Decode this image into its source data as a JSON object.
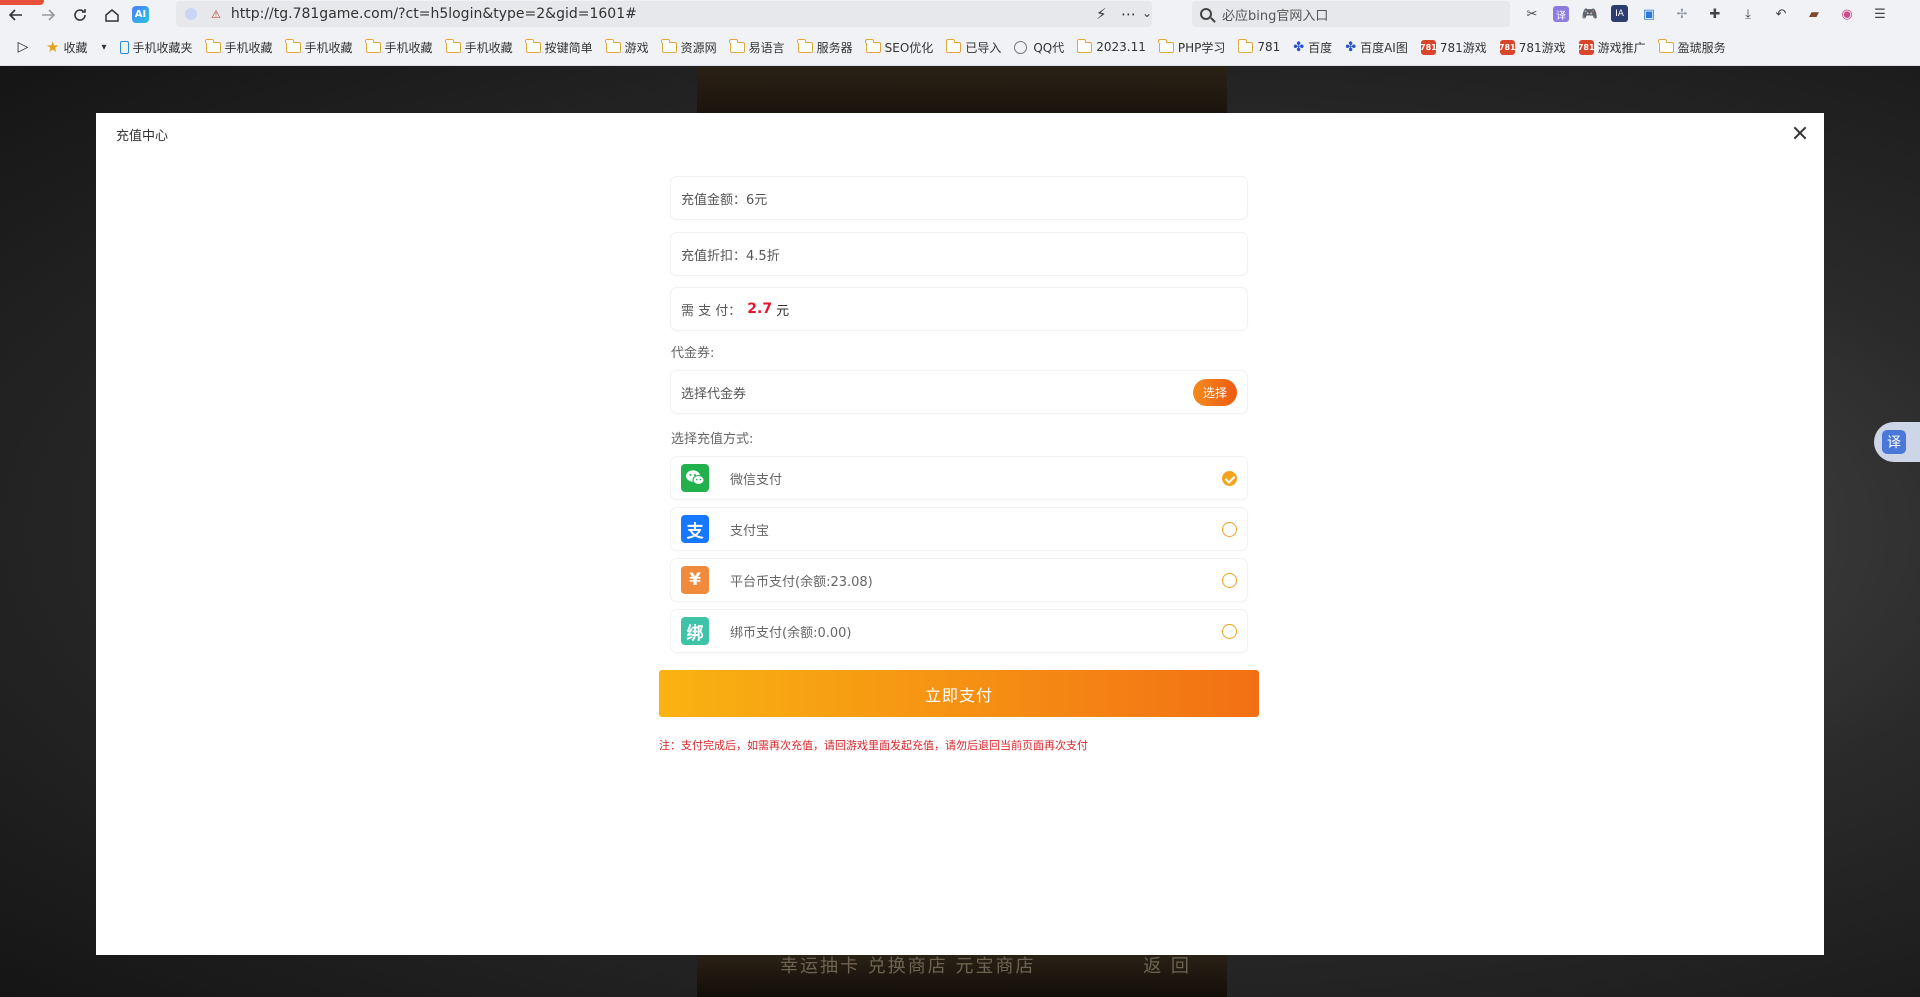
{
  "browser": {
    "url": "http://tg.781game.com/?ct=h5login&type=2&gid=1601#",
    "search_placeholder": "必应bing官网入口",
    "ai_label": "AI"
  },
  "bookmarks": [
    {
      "label": "收藏",
      "icon": "star-icon"
    },
    {
      "label": "手机收藏夹",
      "icon": "phone-icon"
    },
    {
      "label": "手机收藏",
      "icon": "folder-icon"
    },
    {
      "label": "手机收藏",
      "icon": "folder-icon"
    },
    {
      "label": "手机收藏",
      "icon": "folder-icon"
    },
    {
      "label": "手机收藏",
      "icon": "folder-icon"
    },
    {
      "label": "按键简单",
      "icon": "folder-icon"
    },
    {
      "label": "游戏",
      "icon": "folder-icon"
    },
    {
      "label": "资源网",
      "icon": "folder-icon"
    },
    {
      "label": "易语言",
      "icon": "folder-icon"
    },
    {
      "label": "服务器",
      "icon": "folder-icon"
    },
    {
      "label": "SEO优化",
      "icon": "folder-icon"
    },
    {
      "label": "已导入",
      "icon": "folder-icon"
    },
    {
      "label": "QQ代",
      "icon": "globe-icon"
    },
    {
      "label": "2023.11",
      "icon": "folder-icon"
    },
    {
      "label": "PHP学习",
      "icon": "folder-icon"
    },
    {
      "label": "781",
      "icon": "folder-icon"
    },
    {
      "label": "百度",
      "icon": "paw-icon"
    },
    {
      "label": "百度AI图",
      "icon": "paw-icon"
    },
    {
      "label": "781游戏",
      "icon": "badge-icon",
      "badge": "781"
    },
    {
      "label": "781游戏",
      "icon": "badge-icon",
      "badge": "781"
    },
    {
      "label": "游戏推广",
      "icon": "badge-icon",
      "badge": "781"
    },
    {
      "label": "盈琥服务",
      "icon": "folder-icon"
    }
  ],
  "background": {
    "bottom_text": "幸运抽卡 兑换商店 元宝商店",
    "bottom_right": "返 回",
    "translate_label": "译"
  },
  "modal": {
    "title": "充值中心",
    "amount_label": "充值金额：",
    "amount_value": "6元",
    "discount_label": "充值折扣：",
    "discount_value": "4.5折",
    "need_pay_label": "需 支 付：",
    "need_pay_value": "2.7",
    "need_pay_unit": "元",
    "coupon_section": "代金券:",
    "coupon_placeholder": "选择代金券",
    "coupon_button": "选择",
    "method_section": "选择充值方式:",
    "methods": [
      {
        "label": "微信支付",
        "icon": "wechat-pay-icon",
        "icon_color": "#22b14c",
        "glyph": "",
        "checked": true
      },
      {
        "label": "支付宝",
        "icon": "alipay-icon",
        "icon_color": "#1677ff",
        "glyph": "支",
        "checked": false
      },
      {
        "label": "平台币支付(余额:23.08)",
        "icon": "platform-coin-icon",
        "icon_color": "#f08a3c",
        "glyph": "¥",
        "checked": false
      },
      {
        "label": "绑币支付(余额:0.00)",
        "icon": "bound-coin-icon",
        "icon_color": "#3fc3a8",
        "glyph": "绑",
        "checked": false
      }
    ],
    "pay_button": "立即支付",
    "note": "注：支付完成后，如需再次充值，请回游戏里面发起充值，请勿后退回当前页面再次支付"
  },
  "colors": {
    "accent_orange": "#f27014",
    "accent_yellow": "#f9b312",
    "price_red": "#e6162d"
  }
}
